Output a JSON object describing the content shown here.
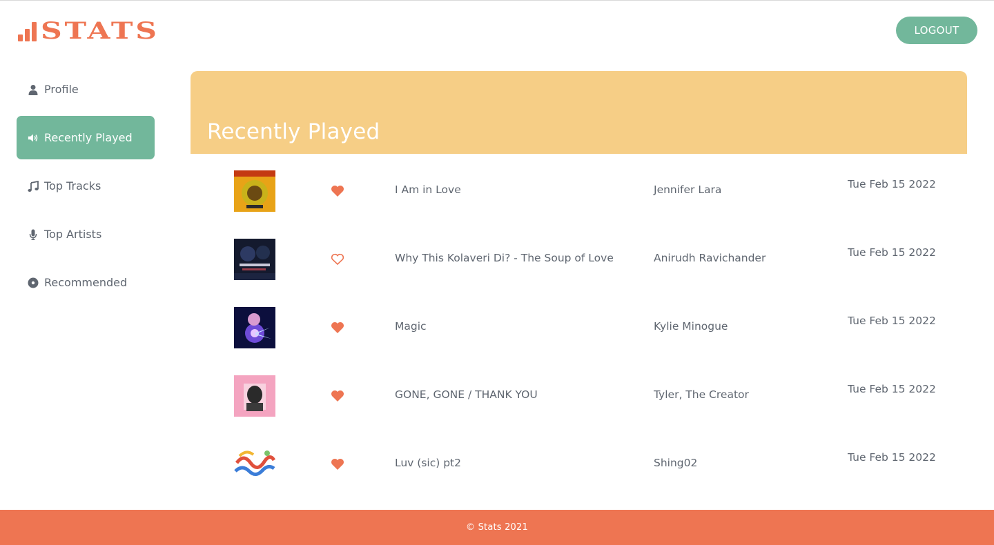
{
  "brand": {
    "logo_text": "STATS",
    "accent_color": "#ee7552",
    "primary_color": "#72b79b",
    "banner_color": "#f6ce86"
  },
  "header": {
    "logout_label": "LOGOUT"
  },
  "sidebar": {
    "items": [
      {
        "label": "Profile",
        "icon": "user-icon",
        "active": false
      },
      {
        "label": "Recently Played",
        "icon": "speaker-icon",
        "active": true
      },
      {
        "label": "Top Tracks",
        "icon": "music-note-icon",
        "active": false
      },
      {
        "label": "Top Artists",
        "icon": "microphone-icon",
        "active": false
      },
      {
        "label": "Recommended",
        "icon": "disc-icon",
        "active": false
      }
    ]
  },
  "main": {
    "title": "Recently Played",
    "tracks": [
      {
        "name": "I Am in Love",
        "artist": "Jennifer Lara",
        "date": "Tue Feb 15 2022",
        "liked": true,
        "cover_palette": [
          "#e8a317",
          "#c43a12",
          "#2b2b2b"
        ]
      },
      {
        "name": "Why This Kolaveri Di? - The Soup of Love",
        "artist": "Anirudh Ravichander",
        "date": "Tue Feb 15 2022",
        "liked": false,
        "cover_palette": [
          "#141a2e",
          "#2d3a63",
          "#9a3d4a"
        ]
      },
      {
        "name": "Magic",
        "artist": "Kylie Minogue",
        "date": "Tue Feb 15 2022",
        "liked": true,
        "cover_palette": [
          "#0c0f3d",
          "#6e4bd8",
          "#e6c6ff"
        ]
      },
      {
        "name": "GONE, GONE / THANK YOU",
        "artist": "Tyler, The Creator",
        "date": "Tue Feb 15 2022",
        "liked": true,
        "cover_palette": [
          "#f4a4c0",
          "#2a2a2a",
          "#f8d2df"
        ]
      },
      {
        "name": "Luv (sic) pt2",
        "artist": "Shing02",
        "date": "Tue Feb 15 2022",
        "liked": true,
        "cover_palette": [
          "#ffffff",
          "#e0503c",
          "#3b7dd8"
        ]
      }
    ]
  },
  "footer": {
    "text": "© Stats 2021"
  }
}
